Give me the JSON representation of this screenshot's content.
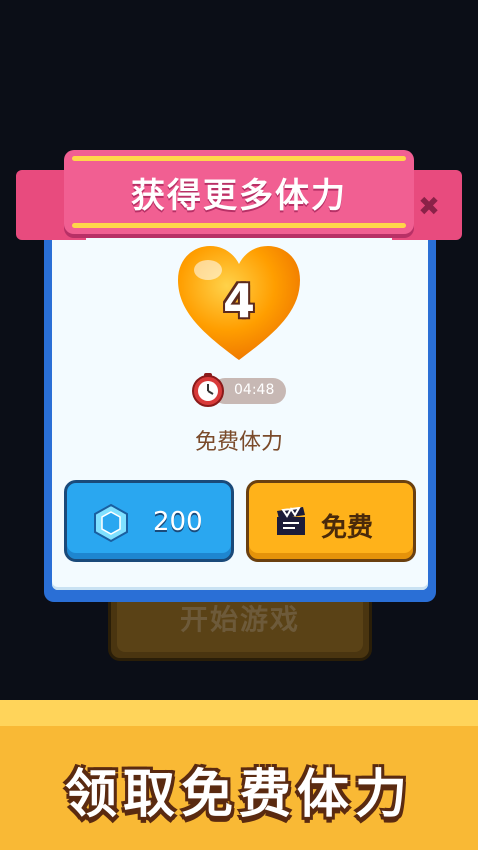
{
  "background": {
    "start_button_label": "开始游戏"
  },
  "dialog": {
    "title": "获得更多体力",
    "energy_count": "4",
    "timer": "04:48",
    "free_energy_label": "免费体力",
    "gem_button": {
      "price": "200",
      "icon": "gem-icon"
    },
    "free_button": {
      "label": "免费",
      "icon": "video-icon"
    },
    "close_icon": "close-icon"
  },
  "banner": {
    "title": "领取免费体力"
  },
  "colors": {
    "ribbon": "#f15f92",
    "panel_border": "#2a6fd6",
    "gem_button": "#2aa7f0",
    "free_button": "#ffb21a",
    "heart": "#ff9e00",
    "banner": "#f9b935"
  }
}
